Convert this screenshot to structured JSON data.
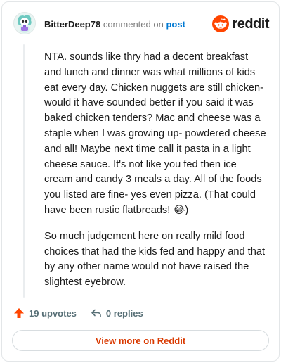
{
  "header": {
    "username": "BitterDeep78",
    "action": "commented on",
    "post_link": "post",
    "brand_name": "reddit"
  },
  "comment": {
    "paragraphs": [
      "NTA. sounds like thry had a decent breakfast and lunch and dinner was what millions of kids eat every day. Chicken nuggets are still chicken- would it have sounded better if you said it was baked chicken tenders? Mac and cheese was a staple when I was growing up- powdered cheese and all! Maybe next time call it pasta in a light cheese sauce. It's not like you fed then ice cream and candy 3 meals a day. All of the foods you listed are fine- yes even pizza. (That could have been rustic flatbreads! 😂)",
      "So much judgement here on really mild food choices that had the kids fed and happy and that by any other name would not have raised the slightest eyebrow."
    ]
  },
  "footer": {
    "upvotes": "19 upvotes",
    "replies": "0 replies",
    "view_more": "View more on Reddit"
  },
  "colors": {
    "reddit_orange": "#ff4500",
    "link_blue": "#0079d3",
    "view_more_text": "#d93900"
  },
  "icons": {
    "avatar": "avatar-icon",
    "logo": "reddit-logo-icon",
    "upvote": "upvote-arrow-icon",
    "reply": "reply-arrow-icon"
  }
}
